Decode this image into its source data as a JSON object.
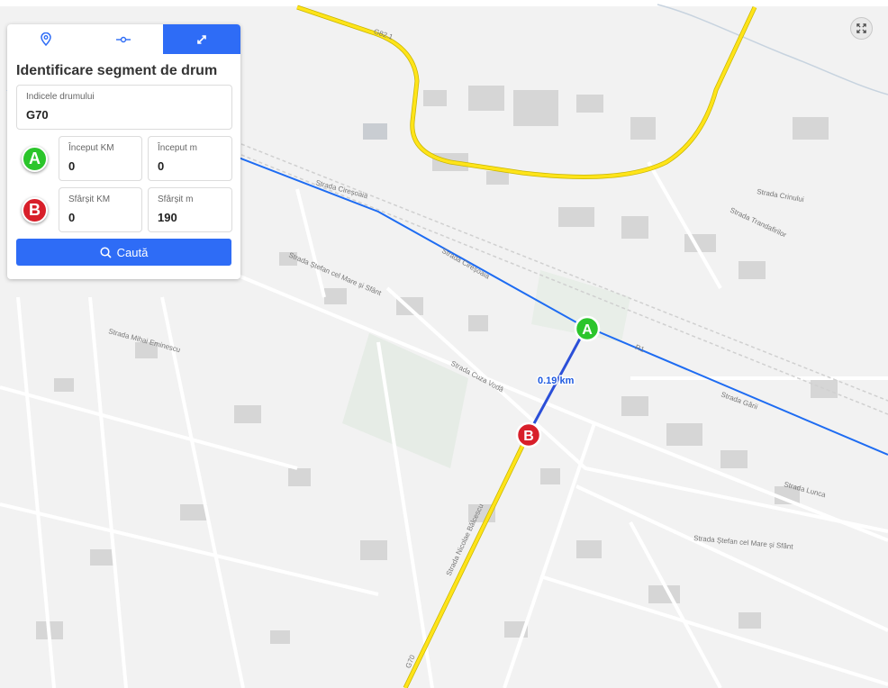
{
  "panel": {
    "tabs": [
      {
        "icon": "location-pin-icon"
      },
      {
        "icon": "route-segment-icon"
      },
      {
        "icon": "expand-arrows-icon",
        "active": true
      }
    ],
    "title": "Identificare segment de drum",
    "road_index": {
      "label": "Indicele drumului",
      "value": "G70"
    },
    "start": {
      "marker": "A",
      "km_label": "Început KM",
      "km_value": "0",
      "m_label": "Început m",
      "m_value": "0"
    },
    "end": {
      "marker": "B",
      "km_label": "Sfârșit KM",
      "km_value": "0",
      "m_label": "Sfârșit m",
      "m_value": "190"
    },
    "search_label": "Caută"
  },
  "map": {
    "road_labels": [
      "G82.1",
      "R1",
      "G70"
    ],
    "segment_distance": "0.19 km",
    "marker_a": "A",
    "marker_b": "B",
    "street_labels": [
      "Strada Ștefan cel Mare și Sfânt",
      "Strada Cireșoaia",
      "Strada Mihai Eminescu",
      "Strada Cuza Vodă",
      "Strada Crinului",
      "Strada Trandafirilor",
      "Strada Nicolae Bălcescu",
      "Strada Ștefan cel Mare și Sfânt",
      "Strada Cireșoaia",
      "Strada Lunca",
      "Strada Gării"
    ],
    "colors": {
      "route_blue": "#1e6cf2",
      "road_yellow": "#ffe419",
      "marker_green": "#2bc52b",
      "marker_red": "#d81f2a"
    }
  },
  "fullscreen": {
    "icon": "fullscreen-icon"
  }
}
